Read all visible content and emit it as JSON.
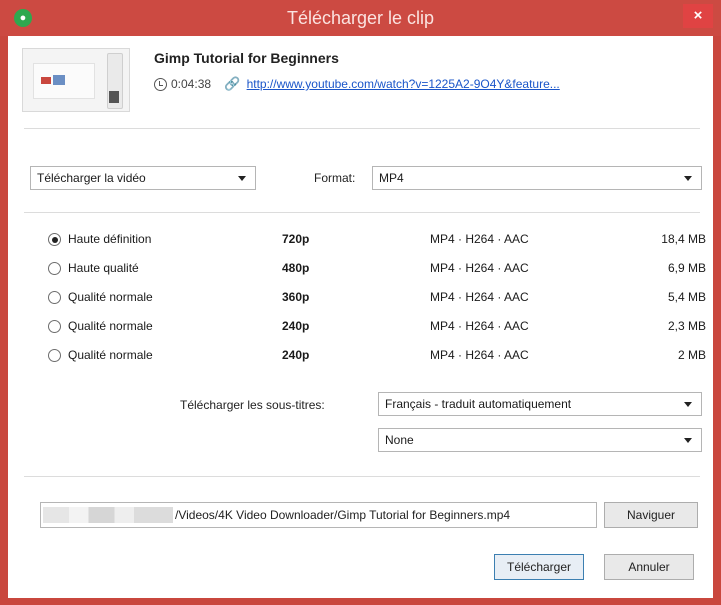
{
  "window": {
    "title": "Télécharger le clip",
    "close_glyph": "×",
    "app_icon": "4k-downloader-icon"
  },
  "clip": {
    "title": "Gimp Tutorial for Beginners",
    "duration": "0:04:38",
    "url": "http://www.youtube.com/watch?v=1225A2-9O4Y&feature..."
  },
  "download_type": {
    "selected": "Télécharger la vidéo"
  },
  "format": {
    "label": "Format:",
    "selected": "MP4"
  },
  "qualities": [
    {
      "label": "Haute définition",
      "resolution": "720p",
      "codec": "MP4 · H264 · AAC",
      "size": "18,4 MB",
      "selected": true
    },
    {
      "label": "Haute qualité",
      "resolution": "480p",
      "codec": "MP4 · H264 · AAC",
      "size": "6,9 MB",
      "selected": false
    },
    {
      "label": "Qualité normale",
      "resolution": "360p",
      "codec": "MP4 · H264 · AAC",
      "size": "5,4 MB",
      "selected": false
    },
    {
      "label": "Qualité normale",
      "resolution": "240p",
      "codec": "MP4 · H264 · AAC",
      "size": "2,3 MB",
      "selected": false
    },
    {
      "label": "Qualité normale",
      "resolution": "240p",
      "codec": "MP4 · H264 · AAC",
      "size": "2 MB",
      "selected": false
    }
  ],
  "subtitles": {
    "label": "Télécharger les sous-titres:",
    "language": "Français - traduit automatiquement",
    "secondary": "None"
  },
  "save_path": "/Videos/4K Video Downloader/Gimp Tutorial for Beginners.mp4",
  "buttons": {
    "browse": "Naviguer",
    "download": "Télécharger",
    "cancel": "Annuler"
  },
  "colors": {
    "titlebar": "#cc4a42",
    "close": "#e04343",
    "link": "#1a55c9"
  }
}
